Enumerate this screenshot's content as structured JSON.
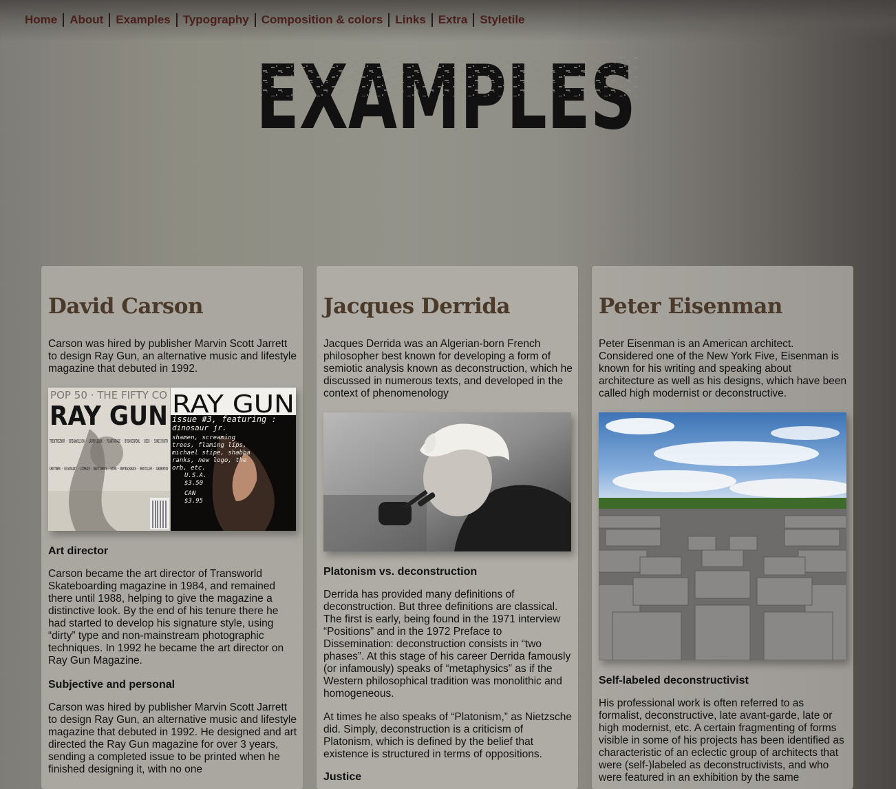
{
  "nav": {
    "items": [
      "Home",
      "About",
      "Examples",
      "Typography",
      "Composition & colors",
      "Links",
      "Extra",
      "Styletile"
    ]
  },
  "hero": {
    "title": "EXAMPLES"
  },
  "cards": [
    {
      "name": "David Carson",
      "intro": "Carson was hired by publisher Marvin Scott Jarrett to design Ray Gun, an alternative music and lifestyle magazine that debuted in 1992.",
      "image": {
        "left_text": "RAY GUN",
        "left_small": "POP 50 · THE FIFTY CO",
        "left_names": "TRENTREZNOR · BRIANWILSON · LARRYCLARK · PLANTAPAGE · BYDAVEGROHL · BECK · SONICYOUTH",
        "left_names2": "KRAFTWERK · GUSVANSANT · LIZPHAIR · BEASTIEBOYS · BJORK · BURTBACHARACH · BENSTILLER · JAKEBURTON",
        "right_title": "RAY GUN",
        "right_sub": "issue #3, featuring :",
        "right_lines": [
          "dinosaur jr.",
          "shamen, screaming",
          "trees, flaming lips,",
          "michael stipe, shabba",
          "ranks, new logo, the",
          "orb, etc."
        ],
        "right_price": [
          "U.S.A.",
          "$3.50",
          "CAN",
          "$3.95"
        ]
      },
      "sections": [
        {
          "heading": "Art director",
          "text": "Carson became the art director of Transworld Skateboarding magazine in 1984, and remained there until 1988, helping to give the magazine a distinctive look. By the end of his tenure there he had started to develop his signature style, using “dirty” type and non-mainstream photographic techniques. In 1992 he became the art director on Ray Gun Magazine."
        },
        {
          "heading": "Subjective and personal",
          "text": "Carson was hired by publisher Marvin Scott Jarrett to design Ray Gun, an alternative music and lifestyle magazine that debuted in 1992. He designed and art directed the Ray Gun magazine for over 3 years, sending a completed issue to be printed when he finished designing it, with no one"
        }
      ]
    },
    {
      "name": "Jacques Derrida",
      "intro": "Jacques Derrida was an Algerian-born French philosopher best known for developing a form of semiotic analysis known as deconstruction, which he discussed in numerous texts, and developed in the context of phenomenology",
      "sections": [
        {
          "heading": "Platonism vs. deconstruction",
          "text": "Derrida has provided many definitions of deconstruction. But three definitions are classical. The first is early, being found in the 1971 interview “Positions” and in the 1972 Preface to Dissemination: deconstruction consists in “two phases”. At this stage of his career Derrida famously (or infamously) speaks of “metaphysics” as if the Western philosophical tradition was monolithic and homogeneous.",
          "text2": "At times he also speaks of “Platonism,” as Nietzsche did. Simply, deconstruction is a criticism of Platonism, which is defined by the belief that existence is structured in terms of oppositions."
        },
        {
          "heading": "Justice",
          "text": ""
        }
      ]
    },
    {
      "name": "Peter Eisenman",
      "intro": "Peter Eisenman is an American architect. Considered one of the New York Five, Eisenman is known for his writing and speaking about architecture as well as his designs, which have been called high modernist or deconstructive.",
      "sections": [
        {
          "heading": "Self-labeled deconstructivist",
          "text": "His professional work is often referred to as formalist, deconstructive, late avant-garde, late or high modernist, etc. A certain fragmenting of forms visible in some of his projects has been identified as characteristic of an eclectic group of architects that were (self-)labeled as deconstructivists, and who were featured in an exhibition by the same"
        }
      ]
    }
  ]
}
